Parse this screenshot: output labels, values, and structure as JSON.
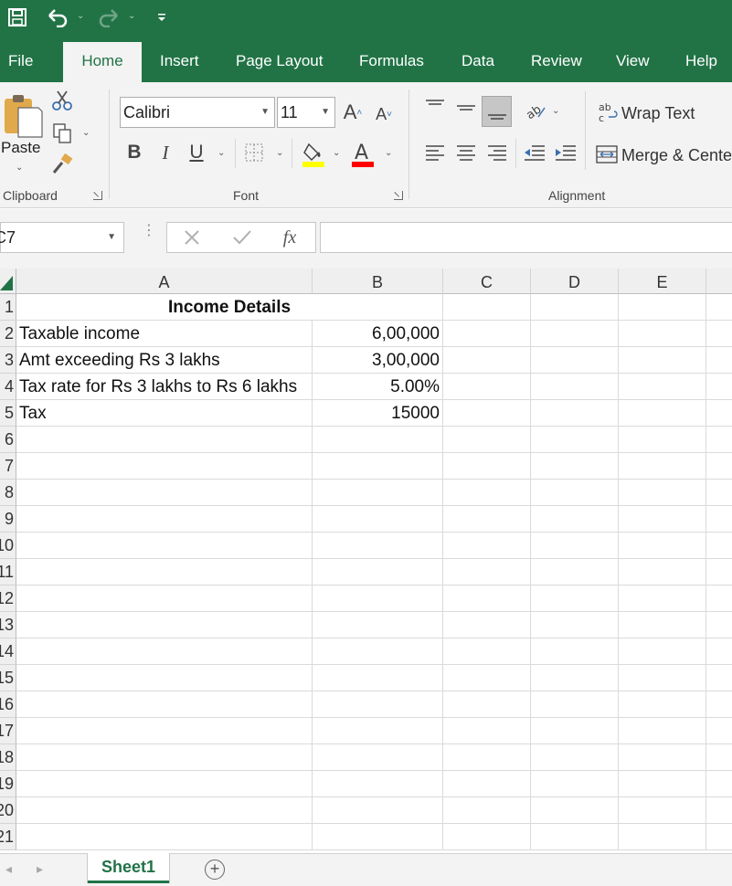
{
  "tabs": [
    "File",
    "Home",
    "Insert",
    "Page Layout",
    "Formulas",
    "Data",
    "Review",
    "View",
    "Help"
  ],
  "active_tab": "Home",
  "ribbon": {
    "clipboard": {
      "paste_label": "Paste",
      "group_label": "Clipboard"
    },
    "font": {
      "name": "Calibri",
      "size": "11",
      "group_label": "Font",
      "bold": "B",
      "italic": "I",
      "underline": "U",
      "fill_color": "#ffff00",
      "font_color": "#ff0000"
    },
    "alignment": {
      "wrap_text": "Wrap Text",
      "merge_center": "Merge & Cente",
      "group_label": "Alignment"
    }
  },
  "formula_bar": {
    "name_box": "C7",
    "fx": "fx",
    "formula": ""
  },
  "grid": {
    "columns": [
      "A",
      "B",
      "C",
      "D",
      "E"
    ],
    "rows": [
      "1",
      "2",
      "3",
      "4",
      "5",
      "6",
      "7",
      "8",
      "9",
      "10",
      "11",
      "12",
      "13",
      "14",
      "15",
      "16",
      "17",
      "18",
      "19",
      "20",
      "21"
    ],
    "cells": {
      "A1": "Income Details",
      "A2": "Taxable income",
      "B2": "6,00,000",
      "A3": "Amt exceeding Rs 3 lakhs",
      "B3": "3,00,000",
      "A4": "Tax rate for Rs 3 lakhs to Rs 6 lakhs",
      "B4": "5.00%",
      "A5": "Tax",
      "B5": "15000"
    }
  },
  "sheets": [
    "Sheet1"
  ],
  "colors": {
    "excel_green": "#217346",
    "ribbon_bg": "#f3f3f3"
  }
}
